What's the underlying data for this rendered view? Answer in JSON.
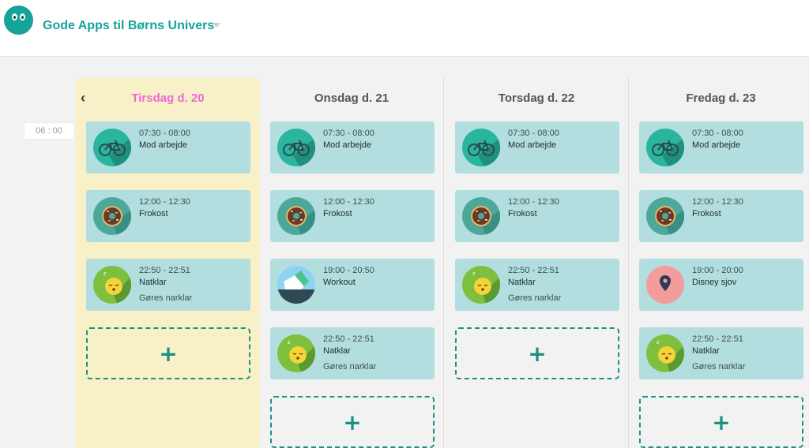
{
  "header": {
    "app_title": "Gode Apps til Børns Univers"
  },
  "time_slot": "06 : 00",
  "days": [
    {
      "label": "Tirsdag d. 20",
      "today": true,
      "events": [
        {
          "time": "07:30 - 08:00",
          "name": "Mod arbejde",
          "note": "",
          "icon": "bicycle-icon"
        },
        {
          "time": "12:00 - 12:30",
          "name": "Frokost",
          "note": "",
          "icon": "donut-icon"
        },
        {
          "time": "22:50 - 22:51",
          "name": "Natklar",
          "note": "Gøres narklar",
          "icon": "sleepy-face-icon"
        }
      ]
    },
    {
      "label": "Onsdag d. 21",
      "today": false,
      "events": [
        {
          "time": "07:30 - 08:00",
          "name": "Mod arbejde",
          "note": "",
          "icon": "bicycle-icon"
        },
        {
          "time": "12:00 - 12:30",
          "name": "Frokost",
          "note": "",
          "icon": "donut-icon"
        },
        {
          "time": "19:00 - 20:50",
          "name": "Workout",
          "note": "",
          "icon": "running-shoe-icon"
        },
        {
          "time": "22:50 - 22:51",
          "name": "Natklar",
          "note": "Gøres narklar",
          "icon": "sleepy-face-icon"
        }
      ]
    },
    {
      "label": "Torsdag d. 22",
      "today": false,
      "events": [
        {
          "time": "07:30 - 08:00",
          "name": "Mod arbejde",
          "note": "",
          "icon": "bicycle-icon"
        },
        {
          "time": "12:00 - 12:30",
          "name": "Frokost",
          "note": "",
          "icon": "donut-icon"
        },
        {
          "time": "22:50 - 22:51",
          "name": "Natklar",
          "note": "Gøres narklar",
          "icon": "sleepy-face-icon"
        }
      ]
    },
    {
      "label": "Fredag d. 23",
      "today": false,
      "events": [
        {
          "time": "07:30 - 08:00",
          "name": "Mod arbejde",
          "note": "",
          "icon": "bicycle-icon"
        },
        {
          "time": "12:00 - 12:30",
          "name": "Frokost",
          "note": "",
          "icon": "donut-icon"
        },
        {
          "time": "19:00 - 20:00",
          "name": "Disney sjov",
          "note": "",
          "icon": "location-pin-icon"
        },
        {
          "time": "22:50 - 22:51",
          "name": "Natklar",
          "note": "Gøres narklar",
          "icon": "sleepy-face-icon"
        }
      ]
    }
  ],
  "add_symbol": "+",
  "colors": {
    "accent": "#16a39a",
    "today_label": "#f06ad6",
    "today_bg": "#f8f0c6",
    "card_bg": "#b3dedf"
  }
}
